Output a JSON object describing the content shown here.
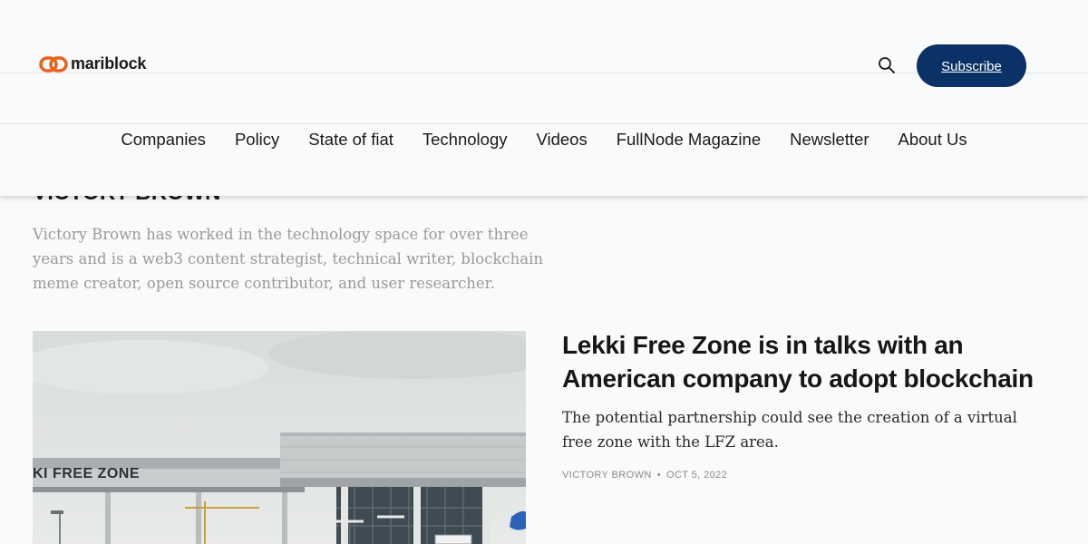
{
  "brand": {
    "name": "mariblock",
    "accent": "#e8621b"
  },
  "header": {
    "subscribe_label": "Subscribe",
    "subscribe_color": "#0b3266",
    "search_icon": "search-icon"
  },
  "nav": {
    "items": [
      {
        "label": "Companies"
      },
      {
        "label": "Policy"
      },
      {
        "label": "State of fiat"
      },
      {
        "label": "Technology"
      },
      {
        "label": "Videos"
      },
      {
        "label": "FullNode Magazine"
      },
      {
        "label": "Newsletter"
      },
      {
        "label": "About Us"
      }
    ]
  },
  "author": {
    "name": "VICTORY BROWN",
    "bio": "Victory Brown has worked in the technology space for over three years and is a web3 content strategist, technical writer, blockchain meme creator, open source contributor, and user researcher."
  },
  "post": {
    "image_sign": "KI FREE ZONE",
    "title": "Lekki Free Zone is in talks with an American company to adopt blockchain",
    "excerpt": "The potential partnership could see the creation of a virtual free zone with the LFZ area.",
    "author": "VICTORY BROWN",
    "date": "OCT 5, 2022"
  }
}
